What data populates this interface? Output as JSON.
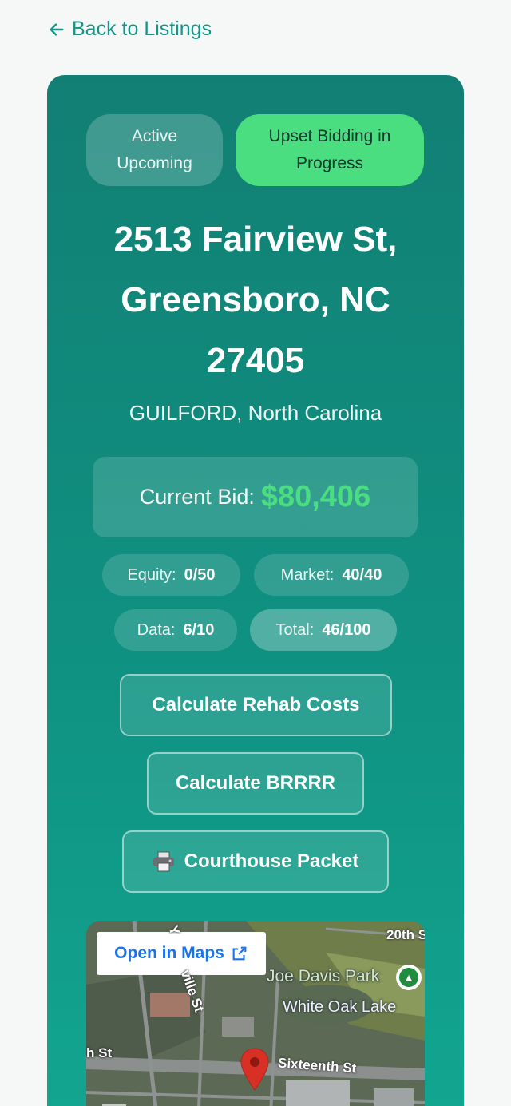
{
  "nav": {
    "back_label": "Back to Listings"
  },
  "badges": {
    "status": "Active Upcoming",
    "bidding": "Upset Bidding in Progress"
  },
  "property": {
    "address": "2513 Fairview St, Greensboro, NC 27405",
    "county_state": "GUILFORD, North Carolina"
  },
  "bid": {
    "label": "Current Bid:",
    "value": "$80,406"
  },
  "scores": [
    {
      "label": "Equity:",
      "value": "0/50"
    },
    {
      "label": "Market:",
      "value": "40/40"
    },
    {
      "label": "Data:",
      "value": "6/10"
    },
    {
      "label": "Total:",
      "value": "46/100"
    }
  ],
  "actions": {
    "rehab": "Calculate Rehab Costs",
    "brrrr": "Calculate BRRRR",
    "packet": "Courthouse Packet",
    "packet_icon": "printer-icon"
  },
  "map": {
    "open_label": "Open in Maps",
    "labels": {
      "street_20th": "20th S",
      "park": "Joe Davis Park",
      "lake": "White Oak Lake",
      "sixteenth": "Sixteenth St",
      "ville": "ville St",
      "h_st": "h St",
      "y": "Y"
    },
    "pin_color": "#d93025",
    "park_icon": "tree-icon"
  },
  "colors": {
    "accent": "#149585",
    "bid_value": "#4ade80",
    "badge_upset": "#4ade80"
  }
}
